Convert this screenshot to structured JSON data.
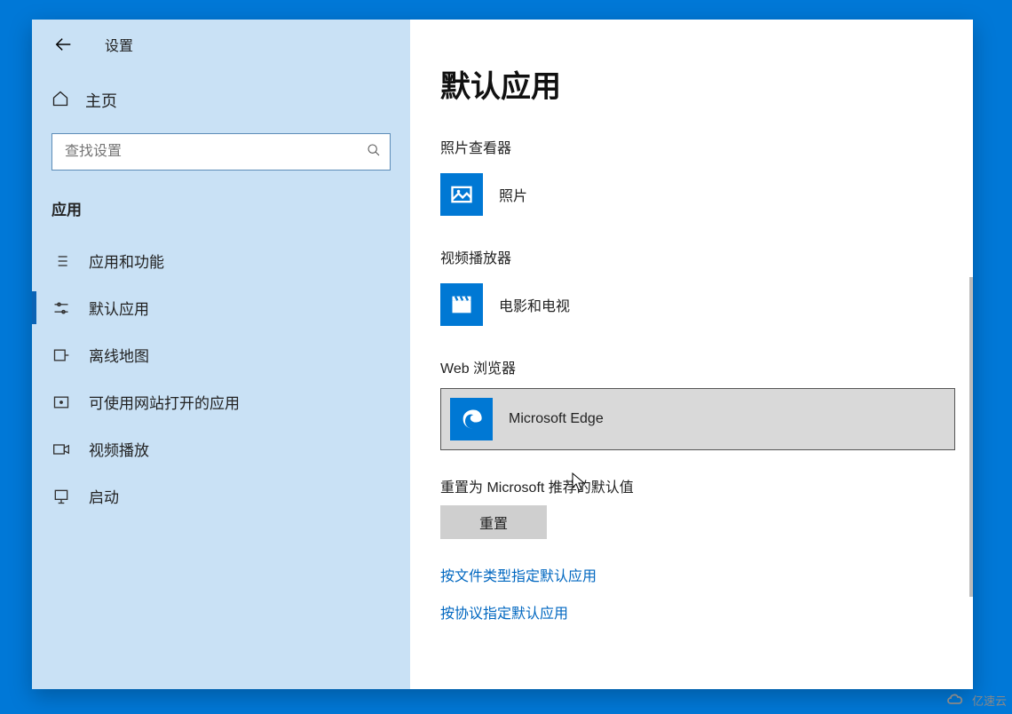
{
  "window": {
    "title": "设置"
  },
  "sidebar": {
    "home_label": "主页",
    "search_placeholder": "查找设置",
    "section_title": "应用",
    "items": [
      {
        "label": "应用和功能"
      },
      {
        "label": "默认应用"
      },
      {
        "label": "离线地图"
      },
      {
        "label": "可使用网站打开的应用"
      },
      {
        "label": "视频播放"
      },
      {
        "label": "启动"
      }
    ]
  },
  "main": {
    "page_title": "默认应用",
    "groups": {
      "photo_viewer": {
        "label": "照片查看器",
        "app": "照片"
      },
      "video_player": {
        "label": "视频播放器",
        "app": "电影和电视"
      },
      "web_browser": {
        "label": "Web 浏览器",
        "app": "Microsoft Edge"
      }
    },
    "reset": {
      "label": "重置为 Microsoft 推荐的默认值",
      "button": "重置"
    },
    "links": {
      "by_file_type": "按文件类型指定默认应用",
      "by_protocol": "按协议指定默认应用"
    }
  },
  "watermark": "亿速云"
}
